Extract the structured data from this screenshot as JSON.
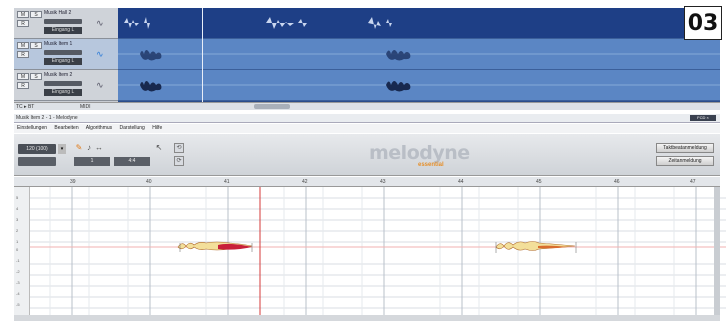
{
  "badge": "03",
  "arranger": {
    "tracks": [
      {
        "name": "Musik Hall 2",
        "io": "Eingang L"
      },
      {
        "name": "Musik Item 1",
        "io": "Eingang L"
      },
      {
        "name": "Musik Item 2",
        "io": "Eingang L"
      }
    ],
    "btn_m": "M",
    "btn_s": "S",
    "btn_r": "R",
    "scroll_left": "TC ▸  BT",
    "scroll_mid": "MIDI"
  },
  "melodyne": {
    "title": "Musik Item 2 - 1 - Melodyne",
    "window_buttons": "FCD  ×",
    "menu": [
      "Einstellungen",
      "Bearbeiten",
      "Algorithmus",
      "Darstellung",
      "Hilfe"
    ],
    "tempo": "120 (100)",
    "value1": "1",
    "value2": "4:4",
    "logo": "melodyne",
    "logo_sub": "essential",
    "btn_right_1": "Taktbeatanmeldung",
    "btn_right_2": "Zeitanmeldung",
    "ruler_ticks": [
      "39",
      "40",
      "41",
      "42",
      "43",
      "44",
      "45",
      "46",
      "47"
    ],
    "pitch_labels": [
      "5",
      "4",
      "3",
      "2",
      "1",
      "0",
      "-1",
      "-2",
      "-3",
      "-4",
      "-5"
    ]
  },
  "colors": {
    "arranger_top_lane": "#1e3f86",
    "arranger_lane": "#5b86c4",
    "blob_dark": "#c8203a",
    "blob_light": "#f7e6a6",
    "logo_accent": "#e58f2b"
  }
}
